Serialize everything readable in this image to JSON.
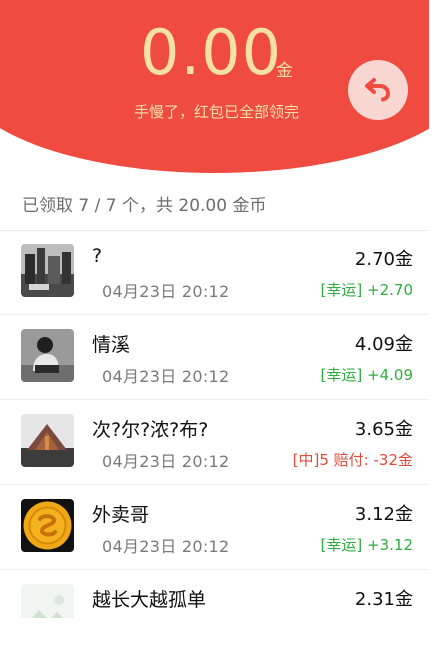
{
  "header": {
    "amount": "0.00",
    "unit": "金",
    "subtitle": "手慢了，红包已全部领完",
    "back_icon": "return-arrow-icon"
  },
  "summary": {
    "text": "已领取 7 / 7 个，共 20.00 金币"
  },
  "colors": {
    "header_red": "#ef4b40",
    "gold_text": "#f7e0a4",
    "lucky_green": "#2fae3f",
    "penalty_red": "#e14b3b"
  },
  "list": [
    {
      "name": "?",
      "time": "04月23日  20:12",
      "coins": "2.70金",
      "tag": "[幸运] +2.70",
      "tag_color": "green"
    },
    {
      "name": "情溪",
      "time": "04月23日  20:12",
      "coins": "4.09金",
      "tag": "[幸运] +4.09",
      "tag_color": "green"
    },
    {
      "name": "次?尔?浓?布?",
      "time": "04月23日  20:12",
      "coins": "3.65金",
      "tag": "[中]5 赔付: -32金",
      "tag_color": "red"
    },
    {
      "name": "外卖哥",
      "time": "04月23日  20:12",
      "coins": "3.12金",
      "tag": "[幸运] +3.12",
      "tag_color": "green"
    },
    {
      "name": "越长大越孤单",
      "time": "",
      "coins": "2.31金",
      "tag": "",
      "tag_color": "green"
    }
  ]
}
